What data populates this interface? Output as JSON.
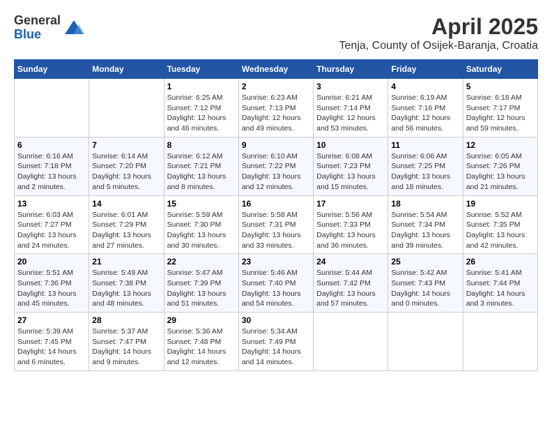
{
  "logo": {
    "general": "General",
    "blue": "Blue"
  },
  "title": {
    "month_year": "April 2025",
    "location": "Tenja, County of Osijek-Baranja, Croatia"
  },
  "weekdays": [
    "Sunday",
    "Monday",
    "Tuesday",
    "Wednesday",
    "Thursday",
    "Friday",
    "Saturday"
  ],
  "weeks": [
    [
      {
        "day": null,
        "info": null
      },
      {
        "day": null,
        "info": null
      },
      {
        "day": "1",
        "info": "Sunrise: 6:25 AM\nSunset: 7:12 PM\nDaylight: 12 hours\nand 46 minutes."
      },
      {
        "day": "2",
        "info": "Sunrise: 6:23 AM\nSunset: 7:13 PM\nDaylight: 12 hours\nand 49 minutes."
      },
      {
        "day": "3",
        "info": "Sunrise: 6:21 AM\nSunset: 7:14 PM\nDaylight: 12 hours\nand 53 minutes."
      },
      {
        "day": "4",
        "info": "Sunrise: 6:19 AM\nSunset: 7:16 PM\nDaylight: 12 hours\nand 56 minutes."
      },
      {
        "day": "5",
        "info": "Sunrise: 6:18 AM\nSunset: 7:17 PM\nDaylight: 12 hours\nand 59 minutes."
      }
    ],
    [
      {
        "day": "6",
        "info": "Sunrise: 6:16 AM\nSunset: 7:18 PM\nDaylight: 13 hours\nand 2 minutes."
      },
      {
        "day": "7",
        "info": "Sunrise: 6:14 AM\nSunset: 7:20 PM\nDaylight: 13 hours\nand 5 minutes."
      },
      {
        "day": "8",
        "info": "Sunrise: 6:12 AM\nSunset: 7:21 PM\nDaylight: 13 hours\nand 8 minutes."
      },
      {
        "day": "9",
        "info": "Sunrise: 6:10 AM\nSunset: 7:22 PM\nDaylight: 13 hours\nand 12 minutes."
      },
      {
        "day": "10",
        "info": "Sunrise: 6:08 AM\nSunset: 7:23 PM\nDaylight: 13 hours\nand 15 minutes."
      },
      {
        "day": "11",
        "info": "Sunrise: 6:06 AM\nSunset: 7:25 PM\nDaylight: 13 hours\nand 18 minutes."
      },
      {
        "day": "12",
        "info": "Sunrise: 6:05 AM\nSunset: 7:26 PM\nDaylight: 13 hours\nand 21 minutes."
      }
    ],
    [
      {
        "day": "13",
        "info": "Sunrise: 6:03 AM\nSunset: 7:27 PM\nDaylight: 13 hours\nand 24 minutes."
      },
      {
        "day": "14",
        "info": "Sunrise: 6:01 AM\nSunset: 7:29 PM\nDaylight: 13 hours\nand 27 minutes."
      },
      {
        "day": "15",
        "info": "Sunrise: 5:59 AM\nSunset: 7:30 PM\nDaylight: 13 hours\nand 30 minutes."
      },
      {
        "day": "16",
        "info": "Sunrise: 5:58 AM\nSunset: 7:31 PM\nDaylight: 13 hours\nand 33 minutes."
      },
      {
        "day": "17",
        "info": "Sunrise: 5:56 AM\nSunset: 7:33 PM\nDaylight: 13 hours\nand 36 minutes."
      },
      {
        "day": "18",
        "info": "Sunrise: 5:54 AM\nSunset: 7:34 PM\nDaylight: 13 hours\nand 39 minutes."
      },
      {
        "day": "19",
        "info": "Sunrise: 5:52 AM\nSunset: 7:35 PM\nDaylight: 13 hours\nand 42 minutes."
      }
    ],
    [
      {
        "day": "20",
        "info": "Sunrise: 5:51 AM\nSunset: 7:36 PM\nDaylight: 13 hours\nand 45 minutes."
      },
      {
        "day": "21",
        "info": "Sunrise: 5:49 AM\nSunset: 7:38 PM\nDaylight: 13 hours\nand 48 minutes."
      },
      {
        "day": "22",
        "info": "Sunrise: 5:47 AM\nSunset: 7:39 PM\nDaylight: 13 hours\nand 51 minutes."
      },
      {
        "day": "23",
        "info": "Sunrise: 5:46 AM\nSunset: 7:40 PM\nDaylight: 13 hours\nand 54 minutes."
      },
      {
        "day": "24",
        "info": "Sunrise: 5:44 AM\nSunset: 7:42 PM\nDaylight: 13 hours\nand 57 minutes."
      },
      {
        "day": "25",
        "info": "Sunrise: 5:42 AM\nSunset: 7:43 PM\nDaylight: 14 hours\nand 0 minutes."
      },
      {
        "day": "26",
        "info": "Sunrise: 5:41 AM\nSunset: 7:44 PM\nDaylight: 14 hours\nand 3 minutes."
      }
    ],
    [
      {
        "day": "27",
        "info": "Sunrise: 5:39 AM\nSunset: 7:45 PM\nDaylight: 14 hours\nand 6 minutes."
      },
      {
        "day": "28",
        "info": "Sunrise: 5:37 AM\nSunset: 7:47 PM\nDaylight: 14 hours\nand 9 minutes."
      },
      {
        "day": "29",
        "info": "Sunrise: 5:36 AM\nSunset: 7:48 PM\nDaylight: 14 hours\nand 12 minutes."
      },
      {
        "day": "30",
        "info": "Sunrise: 5:34 AM\nSunset: 7:49 PM\nDaylight: 14 hours\nand 14 minutes."
      },
      {
        "day": null,
        "info": null
      },
      {
        "day": null,
        "info": null
      },
      {
        "day": null,
        "info": null
      }
    ]
  ]
}
